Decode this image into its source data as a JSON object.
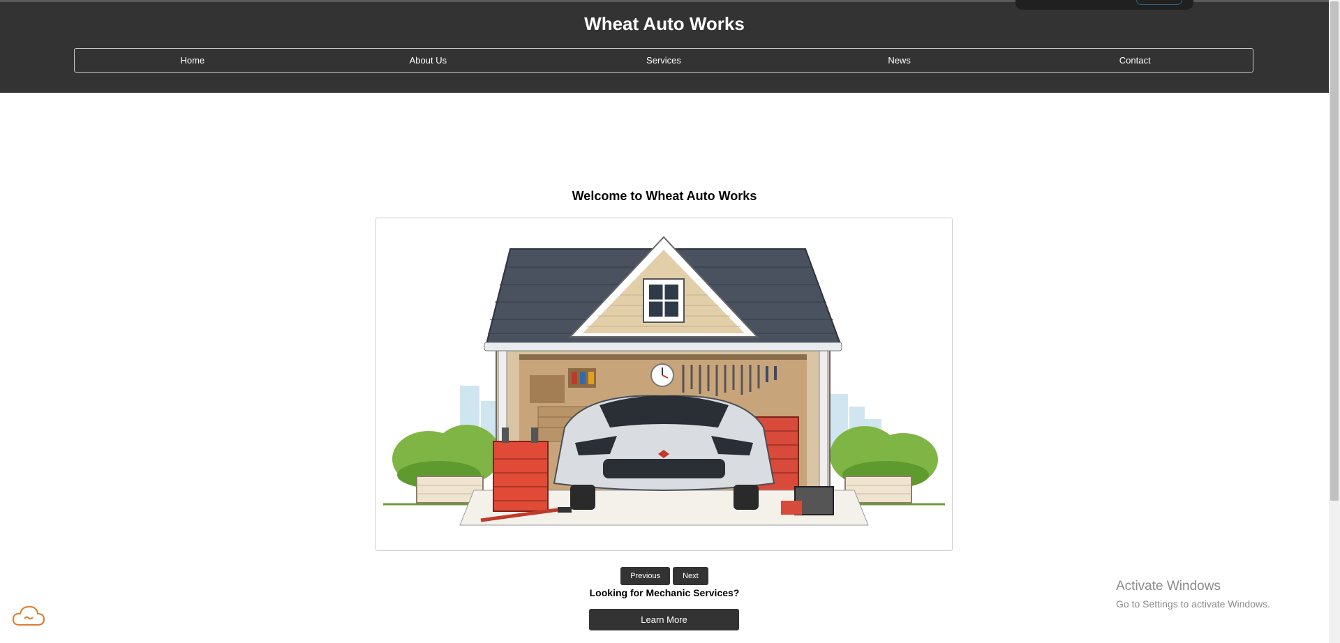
{
  "site": {
    "title": "Wheat Auto Works"
  },
  "nav": {
    "items": [
      {
        "label": "Home"
      },
      {
        "label": "About Us"
      },
      {
        "label": "Services"
      },
      {
        "label": "News"
      },
      {
        "label": "Contact"
      }
    ]
  },
  "main": {
    "welcome": "Welcome to Wheat Auto Works",
    "slider": {
      "image_alt": "Illustration of a garage with tools and a silver sports car",
      "prev_label": "Previous",
      "next_label": "Next"
    },
    "cta_heading": "Looking for Mechanic Services?",
    "cta_button": "Learn More"
  },
  "watermark": {
    "line1": "Activate Windows",
    "line2": "Go to Settings to activate Windows."
  },
  "colors": {
    "header_bg": "#333333",
    "button_bg": "#333333",
    "cloud_icon": "#e07b2a"
  }
}
